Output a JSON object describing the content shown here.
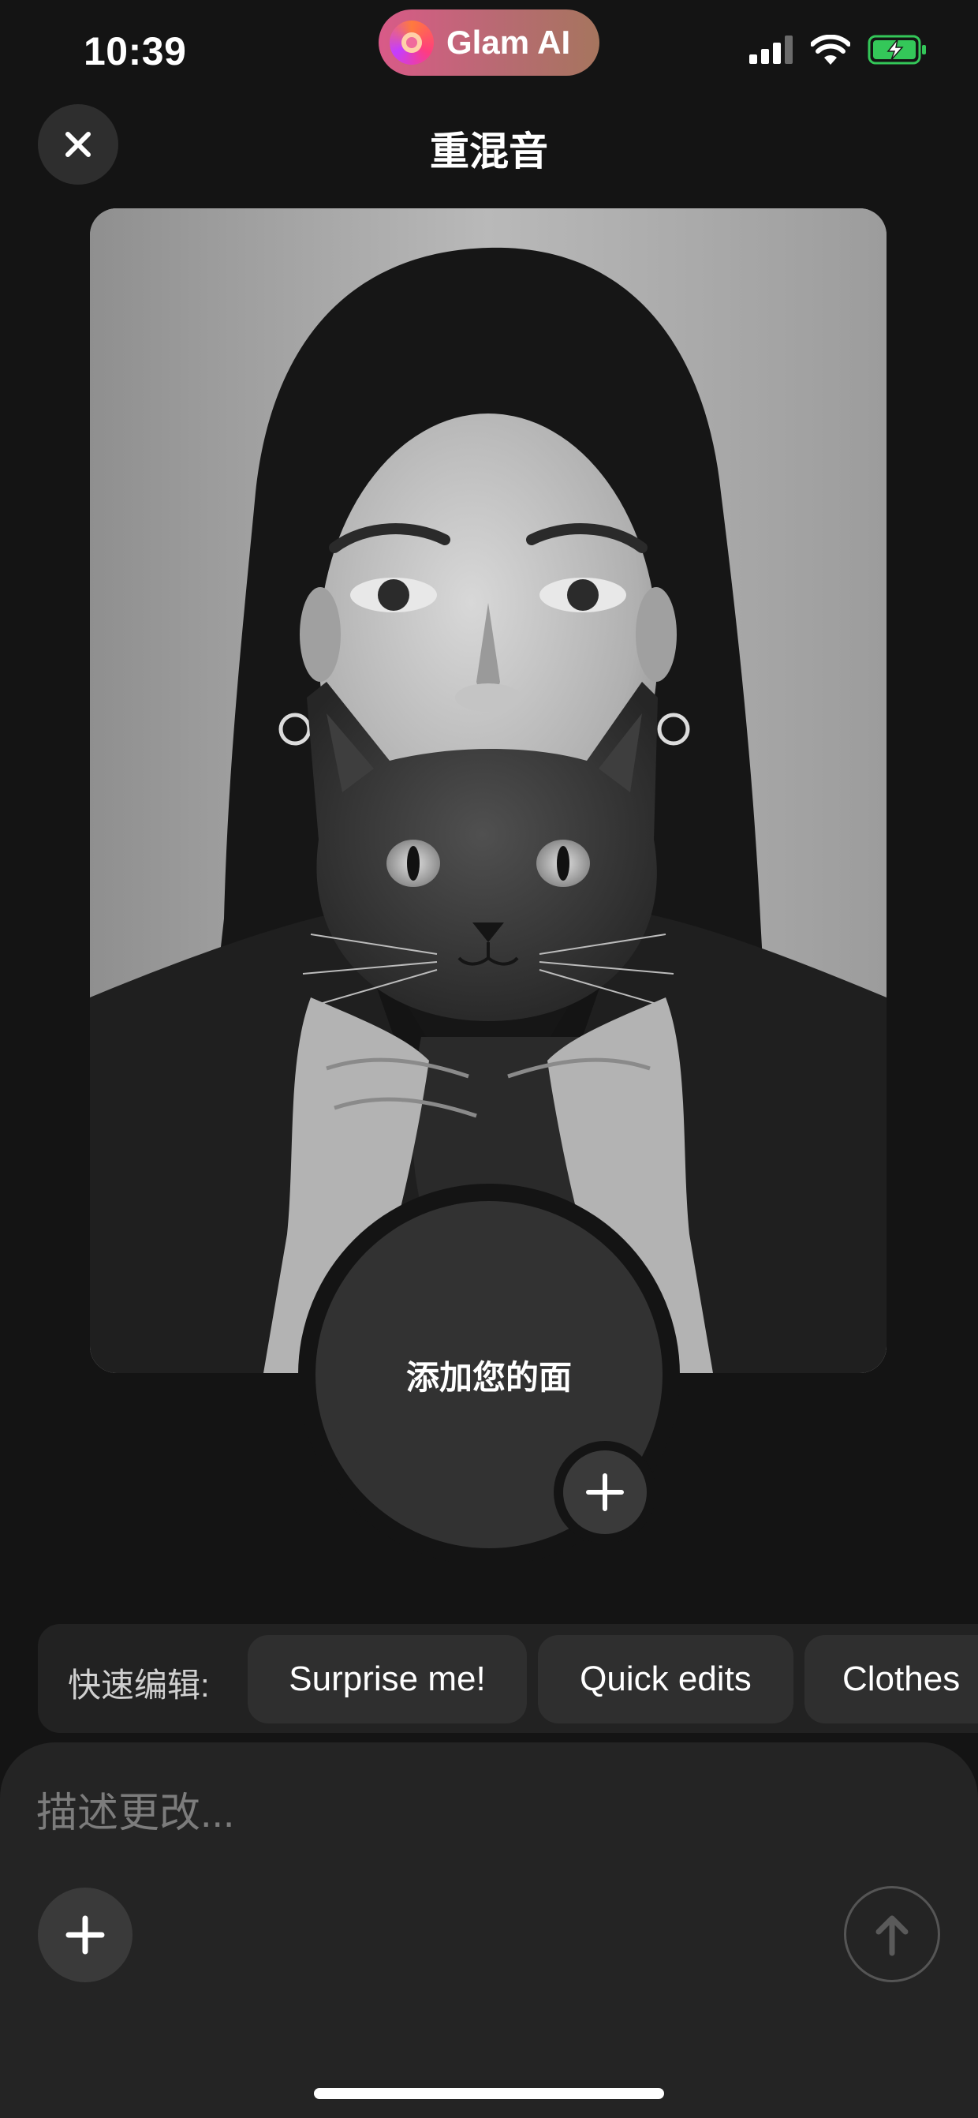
{
  "status_bar": {
    "time": "10:39",
    "app_name": "Glam AI",
    "icons": [
      "signal-icon",
      "wifi-icon",
      "battery-charging-icon"
    ]
  },
  "header": {
    "title": "重混音",
    "close_icon": "close-icon"
  },
  "photo": {
    "subject": "portrait-with-cat"
  },
  "face": {
    "label": "添加您的面",
    "add_icon": "plus-icon"
  },
  "quick_edits": {
    "label": "快速编辑:",
    "chips": [
      "Surprise me!",
      "Quick edits",
      "Clothes"
    ]
  },
  "prompt": {
    "placeholder": "描述更改...",
    "value": "",
    "attach_icon": "plus-icon",
    "send_icon": "arrow-up-icon"
  },
  "colors": {
    "background": "#141414",
    "panel": "#242424",
    "chip": "#2f2f2f",
    "pill_start": "#d95a88",
    "pill_end": "#a6755e",
    "battery_green": "#34c759"
  }
}
